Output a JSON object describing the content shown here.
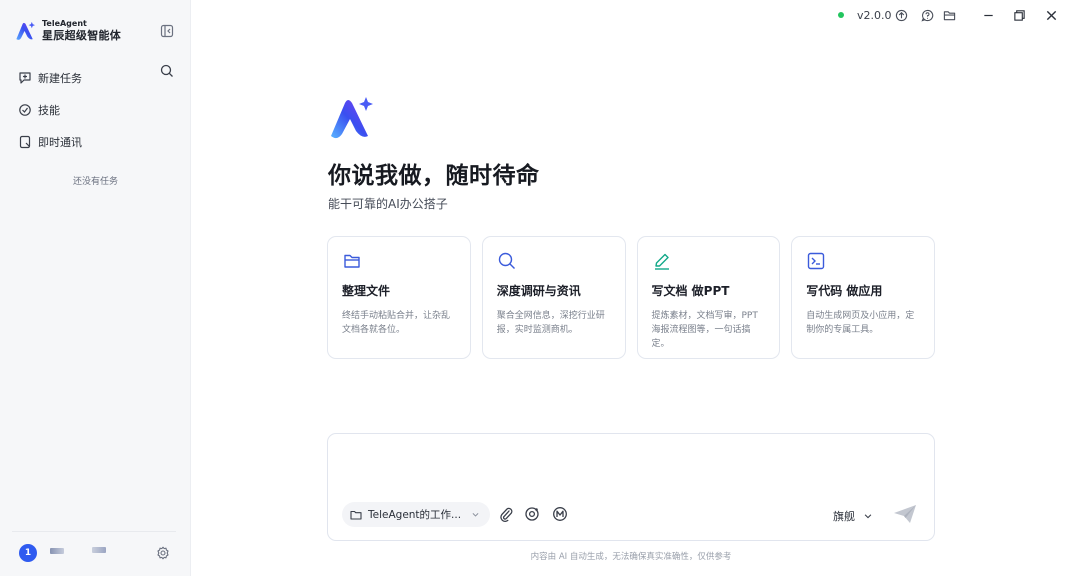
{
  "app": {
    "brand_en": "TeleAgent",
    "brand_cn": "星辰超级智能体",
    "version": "v2.0.0",
    "accent": "#2f5bf0",
    "status_color": "#22c55e"
  },
  "sidebar": {
    "items": [
      {
        "label": "新建任务",
        "icon": "new-task-icon"
      },
      {
        "label": "技能",
        "icon": "skills-icon"
      },
      {
        "label": "即时通讯",
        "icon": "messaging-icon"
      }
    ],
    "empty_text": "还没有任务",
    "avatar_initial": "1"
  },
  "hero": {
    "title": "你说我做，随时待命",
    "subtitle": "能干可靠的AI办公搭子"
  },
  "cards": [
    {
      "title": "整理文件",
      "desc": "终结手动粘贴合并，让杂乱文档各就各位。",
      "icon": "folder-icon"
    },
    {
      "title": "深度调研与资讯",
      "desc": "聚合全网信息，深挖行业研报，实时监测商机。",
      "icon": "search-icon"
    },
    {
      "title": "写文档 做PPT",
      "desc": "提炼素材，文档写审，PPT海报流程图等，一句话搞定。",
      "icon": "pen-icon"
    },
    {
      "title": "写代码 做应用",
      "desc": "自动生成网页及小应用，定制你的专属工具。",
      "icon": "terminal-icon"
    }
  ],
  "composer": {
    "placeholder": "",
    "workspace_label": "TeleAgent的工作...",
    "model_label": "旗舰"
  },
  "footer": {
    "disclaimer": "内容由 AI 自动生成，无法确保真实准确性，仅供参考"
  }
}
